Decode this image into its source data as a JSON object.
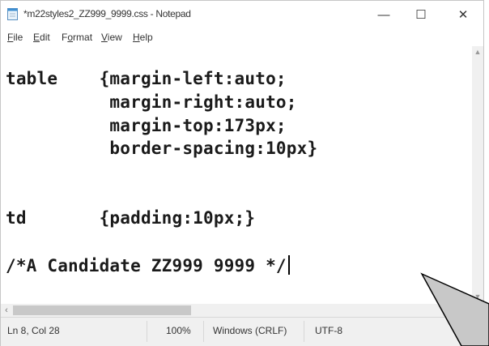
{
  "window": {
    "title": "*m22styles2_ZZ999_9999.css - Notepad",
    "controls": {
      "minimize": "—",
      "maximize": "☐",
      "close": "✕"
    }
  },
  "menu": [
    {
      "first": "F",
      "rest": "ile"
    },
    {
      "first": "E",
      "rest": "dit"
    },
    {
      "first": "F",
      "rest": "ormat",
      "prefix": "F",
      "underline": "o",
      "suffix": "rmat"
    },
    {
      "first": "V",
      "rest": "iew"
    },
    {
      "first": "H",
      "rest": "elp"
    }
  ],
  "editor": {
    "lines": [
      "table    {margin-left:auto;",
      "          margin-right:auto;",
      "          margin-top:173px;",
      "          border-spacing:10px}",
      "",
      "td       {padding:10px;}",
      "",
      "/*A Candidate ZZ999 9999 */"
    ]
  },
  "status": {
    "position": "Ln 8, Col 28",
    "zoom": "100%",
    "line_ending": "Windows (CRLF)",
    "encoding": "UTF-8"
  },
  "icons": {
    "app": "notepad-icon",
    "scroll_up": "scroll-up-arrow-icon",
    "scroll_down": "scroll-down-arrow-icon",
    "scroll_left": "scroll-left-arrow-icon"
  },
  "colors": {
    "callout_fill": "#c8c8c8",
    "callout_stroke": "#000000"
  }
}
